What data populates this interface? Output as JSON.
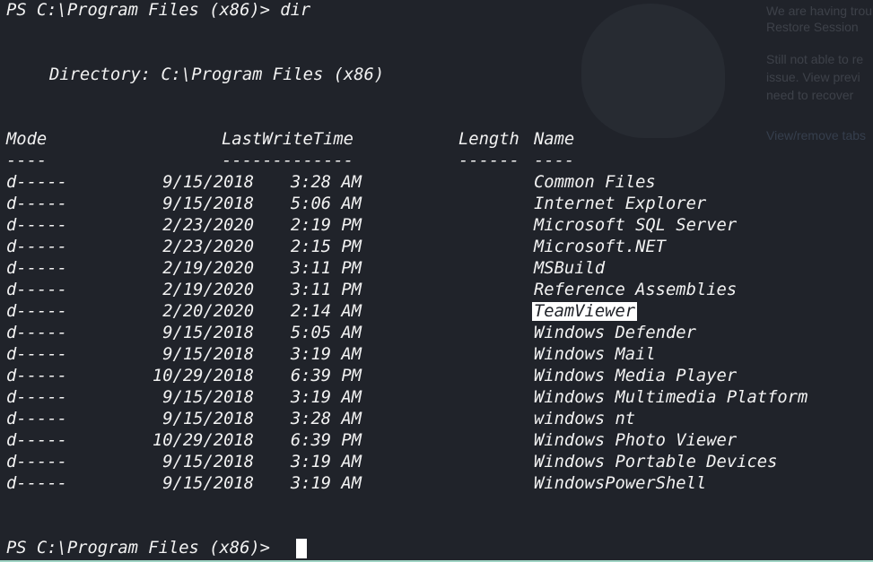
{
  "background_notice": {
    "line1": "We are having trouble",
    "line2": "Restore Session",
    "line3": "Still not able to re",
    "line4": "issue. View previ",
    "line5": "need to recover",
    "link": "View/remove tabs"
  },
  "terminal": {
    "prompt1": "PS C:\\Program Files (x86)> dir",
    "directory_header": "Directory: C:\\Program Files (x86)",
    "headers": {
      "mode": "Mode",
      "last_write_time": "LastWriteTime",
      "length": "Length",
      "name": "Name"
    },
    "underlines": {
      "mode": "----",
      "last_write_time": "-------------",
      "length": "------",
      "name": "----"
    },
    "rows": [
      {
        "mode": "d-----",
        "date": "9/15/2018",
        "time": "3:28 AM",
        "name": "Common Files"
      },
      {
        "mode": "d-----",
        "date": "9/15/2018",
        "time": "5:06 AM",
        "name": "Internet Explorer"
      },
      {
        "mode": "d-----",
        "date": "2/23/2020",
        "time": "2:19 PM",
        "name": "Microsoft SQL Server"
      },
      {
        "mode": "d-----",
        "date": "2/23/2020",
        "time": "2:15 PM",
        "name": "Microsoft.NET"
      },
      {
        "mode": "d-----",
        "date": "2/19/2020",
        "time": "3:11 PM",
        "name": "MSBuild"
      },
      {
        "mode": "d-----",
        "date": "2/19/2020",
        "time": "3:11 PM",
        "name": "Reference Assemblies"
      },
      {
        "mode": "d-----",
        "date": "2/20/2020",
        "time": "2:14 AM",
        "name": "TeamViewer",
        "selected": true
      },
      {
        "mode": "d-----",
        "date": "9/15/2018",
        "time": "5:05 AM",
        "name": "Windows Defender"
      },
      {
        "mode": "d-----",
        "date": "9/15/2018",
        "time": "3:19 AM",
        "name": "Windows Mail"
      },
      {
        "mode": "d-----",
        "date": "10/29/2018",
        "time": "6:39 PM",
        "name": "Windows Media Player"
      },
      {
        "mode": "d-----",
        "date": "9/15/2018",
        "time": "3:19 AM",
        "name": "Windows Multimedia Platform"
      },
      {
        "mode": "d-----",
        "date": "9/15/2018",
        "time": "3:28 AM",
        "name": "windows nt"
      },
      {
        "mode": "d-----",
        "date": "10/29/2018",
        "time": "6:39 PM",
        "name": "Windows Photo Viewer"
      },
      {
        "mode": "d-----",
        "date": "9/15/2018",
        "time": "3:19 AM",
        "name": "Windows Portable Devices"
      },
      {
        "mode": "d-----",
        "date": "9/15/2018",
        "time": "3:19 AM",
        "name": "WindowsPowerShell"
      }
    ],
    "prompt2": "PS C:\\Program Files (x86)>"
  },
  "colors": {
    "background": "#20232a",
    "text": "#f2f2f2",
    "selection": "#ffffff",
    "accent_strip": "#9fd4c4"
  }
}
